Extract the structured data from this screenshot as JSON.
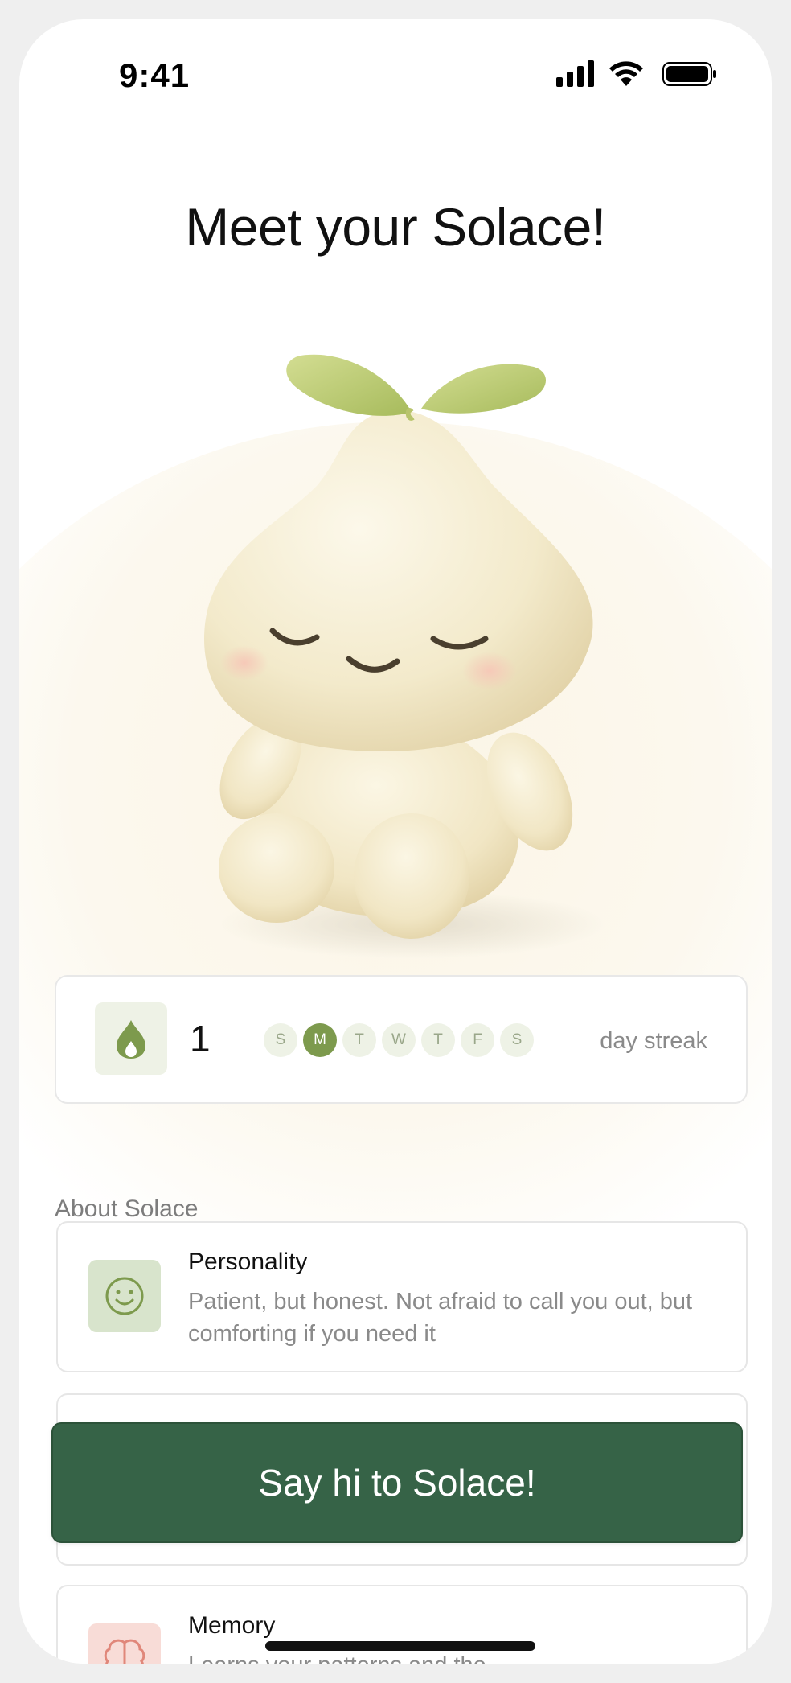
{
  "status_bar": {
    "time": "9:41",
    "icons": [
      "signal-icon",
      "wifi-icon",
      "battery-icon"
    ]
  },
  "page": {
    "title": "Meet your Solace!"
  },
  "streak": {
    "count": "1",
    "days": [
      "S",
      "M",
      "T",
      "W",
      "T",
      "F",
      "S"
    ],
    "active_day_index": 1,
    "label": "day streak",
    "icon": "flame-icon"
  },
  "about": {
    "heading": "About Solace",
    "cards": [
      {
        "title": "Personality",
        "body": "Patient, but honest. Not afraid to call you out, but comforting if you need it",
        "icon": "smiley-icon"
      },
      {
        "title": "Memory",
        "body": "Learns your patterns and the",
        "icon": "brain-icon"
      }
    ]
  },
  "cta": {
    "label": "Say hi to Solace!"
  },
  "colors": {
    "brand_green": "#366347",
    "accent_olive": "#7d9a4d",
    "chip_bg": "#eef2e6",
    "personality_icon_bg": "#d8e4cc",
    "memory_icon_bg": "#f8dcd7"
  }
}
